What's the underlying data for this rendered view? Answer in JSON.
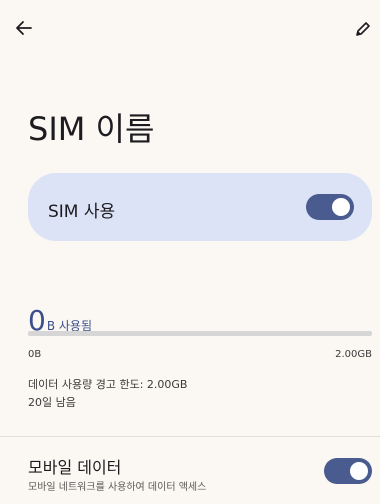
{
  "header": {
    "back_icon": "arrow-left-icon",
    "edit_icon": "pencil-icon"
  },
  "title": "SIM 이름",
  "sim": {
    "label": "SIM 사용",
    "enabled": true
  },
  "usage": {
    "amount": "0",
    "unit_label": "B 사용됨",
    "progress": 0,
    "min_label": "0B",
    "max_label": "2.00GB",
    "warning": "데이터 사용량 경고 한도: 2.00GB",
    "remaining": "20일 남음"
  },
  "mobile_data": {
    "title": "모바일 데이터",
    "subtitle": "모바일 네트워크를 사용하여 데이터 액세스",
    "enabled": true
  },
  "colors": {
    "accent": "#3d4f8a",
    "toggle": "#4a5b8f",
    "card": "#dde3f7",
    "background": "#fbf8f3"
  }
}
